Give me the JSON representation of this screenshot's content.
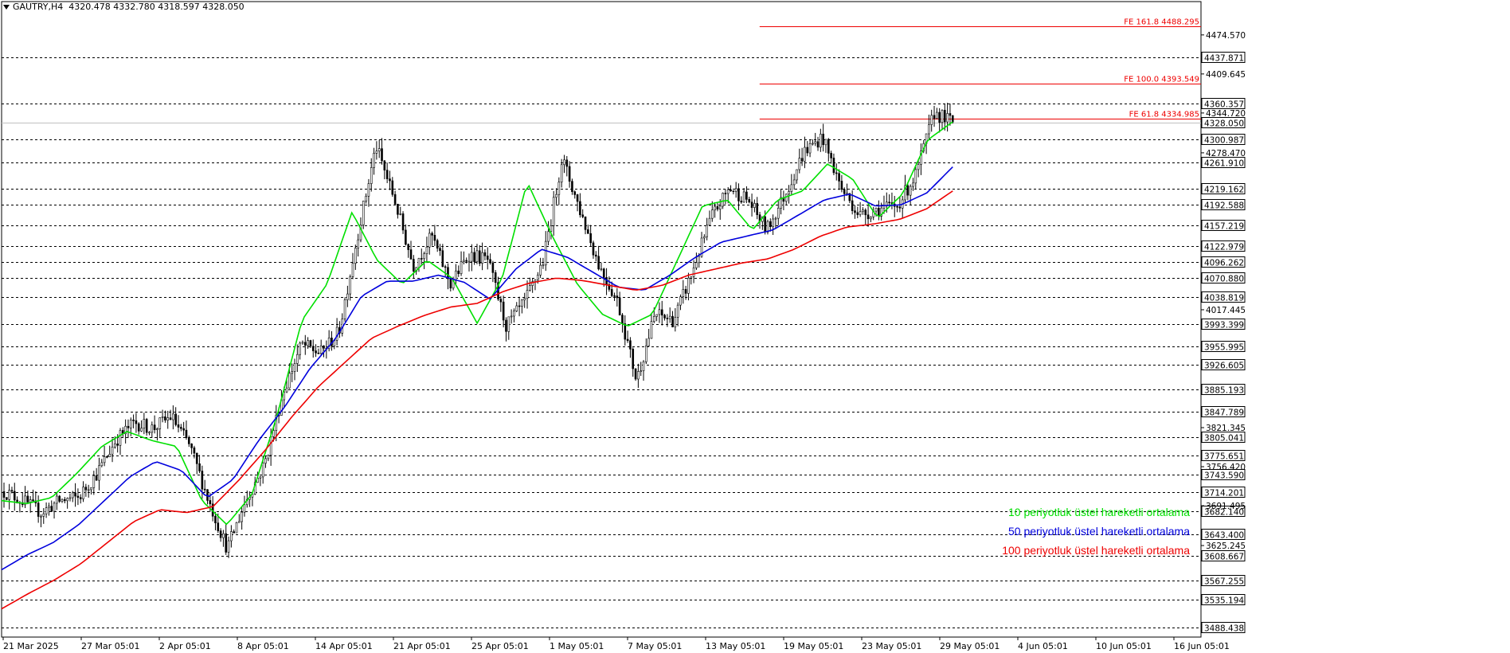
{
  "header": {
    "symbol": "GAUTRY,H4",
    "ohlc": "4320.478 4332.780 4318.597 4328.050"
  },
  "colors": {
    "ema10": "#00e000",
    "ema50": "#0000dd",
    "ema100": "#ee0000",
    "fib": "#ee0000",
    "candles": "#000000",
    "grid": "#000000",
    "background": "#ffffff"
  },
  "chart_data": {
    "type": "candlestick",
    "symbol": "GAUTRY",
    "timeframe": "H4",
    "ylim": [
      3473,
      4530
    ],
    "x_tick_labels": [
      "21 Mar 2025",
      "27 Mar 05:01",
      "2 Apr 05:01",
      "8 Apr 05:01",
      "14 Apr 05:01",
      "21 Apr 05:01",
      "25 Apr 05:01",
      "1 May 05:01",
      "7 May 05:01",
      "13 May 05:01",
      "19 May 05:01",
      "23 May 05:01",
      "29 May 05:01",
      "4 Jun 05:01",
      "10 Jun 05:01",
      "16 Jun 05:01"
    ],
    "price_axis_plain": [
      "4474.570",
      "4409.645",
      "4344.720",
      "4278.470",
      "4017.445",
      "3821.345",
      "3756.420",
      "3691.495",
      "3625.245"
    ],
    "price_levels": [
      "4437.871",
      "4360.357",
      "4328.050",
      "4300.987",
      "4261.910",
      "4219.162",
      "4192.588",
      "4157.219",
      "4122.979",
      "4096.262",
      "4070.880",
      "4038.819",
      "3993.399",
      "3955.995",
      "3926.605",
      "3885.193",
      "3847.789",
      "3805.041",
      "3775.651",
      "3743.590",
      "3714.201",
      "3682.140",
      "3643.400",
      "3608.667",
      "3567.255",
      "3535.194",
      "3488.438"
    ],
    "current_price": "4328.050",
    "fibonacci_extensions": [
      {
        "label": "FE 161.8 4488.295",
        "value": 4488.295
      },
      {
        "label": "FE 100.0 4393.549",
        "value": 4393.549
      },
      {
        "label": "FE 61.8 4334.985",
        "value": 4334.985
      }
    ],
    "series": [
      {
        "name": "10 periyotluk üstel hareketli ortalama",
        "key": "ema10",
        "values": [
          3700,
          3695,
          3705,
          3745,
          3790,
          3815,
          3800,
          3790,
          3700,
          3660,
          3710,
          3840,
          4000,
          4060,
          4180,
          4100,
          4060,
          4100,
          4070,
          3995,
          4070,
          4230,
          4140,
          4060,
          4010,
          3990,
          4010,
          4100,
          4190,
          4200,
          4150,
          4200,
          4215,
          4260,
          4235,
          4170,
          4210,
          4300,
          4330
        ]
      },
      {
        "name": "50 periyotluk üstel hareketli ortalama",
        "key": "ema50",
        "values": [
          3585,
          3610,
          3630,
          3660,
          3700,
          3740,
          3765,
          3750,
          3705,
          3735,
          3800,
          3855,
          3920,
          3970,
          4040,
          4065,
          4065,
          4075,
          4063,
          4035,
          4085,
          4118,
          4105,
          4080,
          4055,
          4050,
          4075,
          4105,
          4130,
          4140,
          4150,
          4175,
          4200,
          4210,
          4190,
          4192,
          4212,
          4255
        ]
      },
      {
        "name": "100 periyotluk üstel hareketli ortalama",
        "key": "ema100",
        "values": [
          3520,
          3545,
          3568,
          3595,
          3630,
          3665,
          3685,
          3680,
          3690,
          3735,
          3785,
          3840,
          3890,
          3930,
          3970,
          3990,
          4008,
          4022,
          4028,
          4048,
          4062,
          4070,
          4066,
          4058,
          4050,
          4058,
          4075,
          4085,
          4095,
          4102,
          4118,
          4140,
          4155,
          4160,
          4168,
          4185,
          4215
        ]
      }
    ],
    "price_path": [
      3715,
      3700,
      3680,
      3700,
      3705,
      3745,
      3800,
      3830,
      3820,
      3840,
      3790,
      3700,
      3620,
      3700,
      3760,
      3880,
      3960,
      3945,
      3980,
      4140,
      4290,
      4200,
      4090,
      4140,
      4060,
      4110,
      4100,
      3990,
      4030,
      4100,
      4270,
      4180,
      4090,
      4030,
      3900,
      4010,
      4000,
      4080,
      4170,
      4220,
      4200,
      4150,
      4210,
      4280,
      4305,
      4220,
      4175,
      4185,
      4190,
      4240,
      4345,
      4330
    ]
  }
}
